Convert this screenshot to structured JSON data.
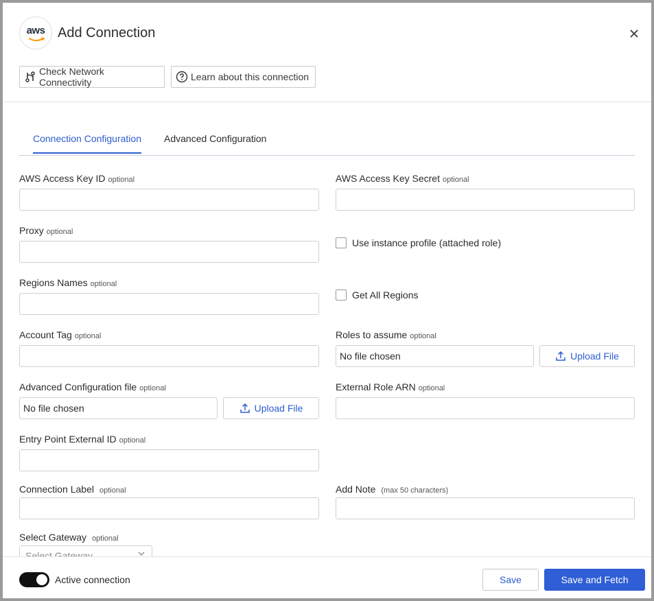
{
  "dialog": {
    "title": "Add Connection",
    "logo_text": "aws",
    "close_icon": "close-icon"
  },
  "header_buttons": {
    "network": "Check Network Connectivity",
    "learn": "Learn about this connection"
  },
  "tabs": [
    {
      "label": "Connection Configuration",
      "active": true
    },
    {
      "label": "Advanced Configuration",
      "active": false
    }
  ],
  "optional_text": "optional",
  "fields": {
    "access_key_id": {
      "label": "AWS Access Key ID",
      "value": ""
    },
    "access_key_secret": {
      "label": "AWS Access Key Secret",
      "value": ""
    },
    "proxy": {
      "label": "Proxy",
      "value": ""
    },
    "regions_names": {
      "label": "Regions Names",
      "value": ""
    },
    "account_tag": {
      "label": "Account Tag",
      "value": ""
    },
    "roles_to_assume": {
      "label": "Roles to assume",
      "file": "No file chosen",
      "upload": "Upload File"
    },
    "advanced_config_file": {
      "label": "Advanced Configuration file",
      "file": "No file chosen",
      "upload": "Upload File"
    },
    "external_role_arn": {
      "label": "External Role ARN",
      "value": ""
    },
    "entry_point_external_id": {
      "label": "Entry Point External ID",
      "value": ""
    },
    "connection_label": {
      "label": "Connection Label",
      "value": ""
    },
    "add_note": {
      "label": "Add Note",
      "hint": "(max 50 characters)",
      "value": ""
    },
    "select_gateway": {
      "label": "Select Gateway",
      "placeholder": "Select Gateway"
    }
  },
  "checkboxes": {
    "instance_profile": {
      "label": "Use instance profile (attached role)",
      "checked": false
    },
    "all_regions": {
      "label": "Get All Regions",
      "checked": false
    }
  },
  "footer": {
    "active_label": "Active connection",
    "active": true,
    "save": "Save",
    "save_fetch": "Save and Fetch"
  },
  "colors": {
    "accent": "#2d5ecf",
    "primary_button": "#2f5ed6",
    "toggle_on": "#111111"
  }
}
